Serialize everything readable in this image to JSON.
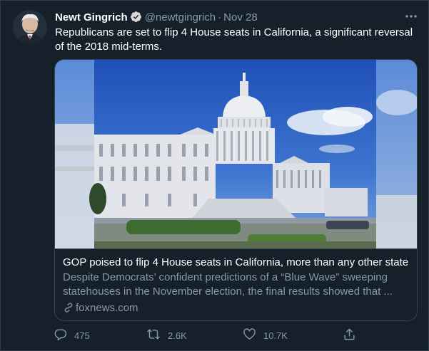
{
  "tweet": {
    "author_name": "Newt Gingrich",
    "handle": "@newtgingrich",
    "separator": "·",
    "date": "Nov 28",
    "text": "Republicans are set to flip 4 House seats in California, a significant reversal of the 2018 mid-terms."
  },
  "card": {
    "title": "GOP poised to flip 4 House seats in California, more than any other state",
    "description": "Despite Democrats’ confident predictions of a “Blue Wave” sweeping statehouses in the November election, the final results showed that ...",
    "source": "foxnews.com"
  },
  "actions": {
    "replies": "475",
    "retweets": "2.6K",
    "likes": "10.7K"
  },
  "icons": {
    "verified": "verified-badge-icon",
    "more": "more-options-icon",
    "link": "link-icon",
    "reply": "reply-icon",
    "retweet": "retweet-icon",
    "like": "heart-icon",
    "share": "share-icon"
  },
  "colors": {
    "background": "#15202b",
    "text_primary": "#ffffff",
    "text_secondary": "#8899a6",
    "border": "#38444d"
  }
}
